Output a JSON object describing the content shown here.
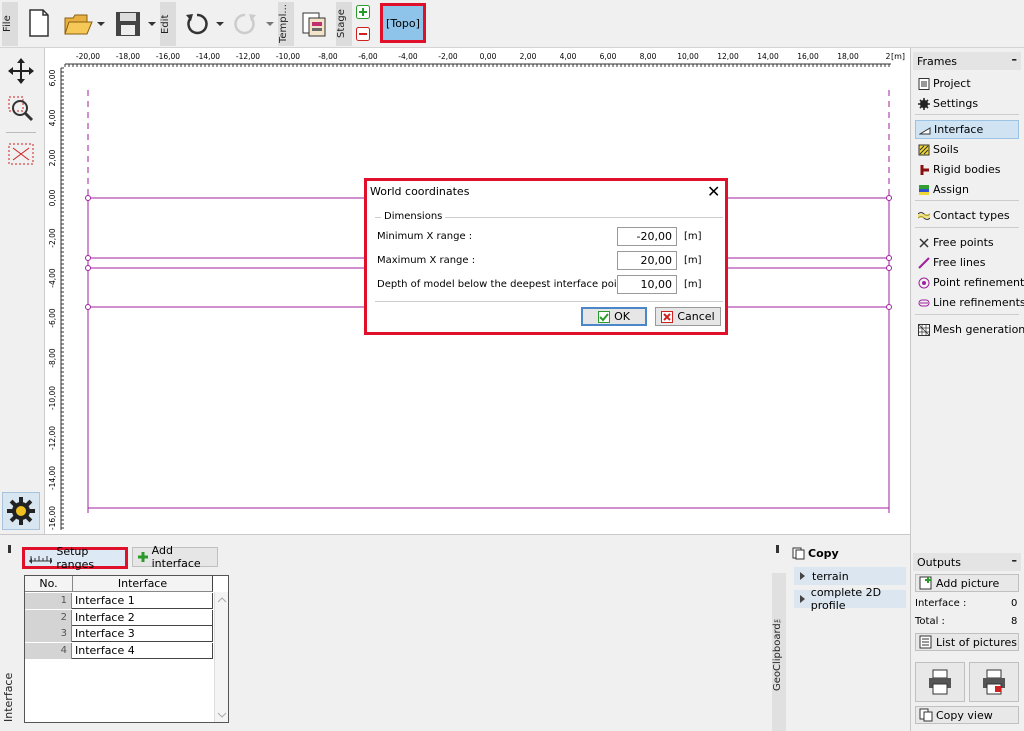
{
  "toolbar": {
    "file_label": "File",
    "edit_label": "Edit",
    "template_label": "Templ...",
    "stage_label": "Stage",
    "topo_label": "[Topo]"
  },
  "ruler": {
    "x_ticks": [
      "-20,00",
      "-18,00",
      "-16,00",
      "-14,00",
      "-12,00",
      "-10,00",
      "-8,00",
      "-6,00",
      "-4,00",
      "-2,00",
      "0,00",
      "2,00",
      "4,00",
      "6,00",
      "8,00",
      "10,00",
      "12,00",
      "14,00",
      "16,00",
      "18,00",
      "2"
    ],
    "x_unit": "[m]",
    "y_ticks": [
      "6,00",
      "4,00",
      "2,00",
      "0,00",
      "-2,00",
      "-4,00",
      "-6,00",
      "-8,00",
      "-10,00",
      "-12,00",
      "-14,00",
      "-16,00"
    ]
  },
  "frames": {
    "title": "Frames",
    "items": [
      {
        "label": "Project",
        "icon": "document-icon"
      },
      {
        "label": "Settings",
        "icon": "gear-icon"
      },
      {
        "label": "Interface",
        "icon": "interface-icon",
        "selected": true
      },
      {
        "label": "Soils",
        "icon": "soil-icon"
      },
      {
        "label": "Rigid bodies",
        "icon": "rigid-body-icon"
      },
      {
        "label": "Assign",
        "icon": "assign-icon"
      },
      {
        "label": "Contact types",
        "icon": "contact-icon"
      },
      {
        "label": "Free points",
        "icon": "free-point-icon"
      },
      {
        "label": "Free lines",
        "icon": "free-line-icon"
      },
      {
        "label": "Point refinements",
        "icon": "point-refinement-icon"
      },
      {
        "label": "Line refinements",
        "icon": "line-refinement-icon"
      },
      {
        "label": "Mesh generation",
        "icon": "mesh-icon"
      }
    ]
  },
  "outputs": {
    "title": "Outputs",
    "add_picture": "Add picture",
    "interface_label": "Interface :",
    "interface_value": "0",
    "total_label": "Total :",
    "total_value": "8",
    "list_of_pictures": "List of pictures",
    "copy_view": "Copy view"
  },
  "bottom": {
    "setup_ranges": "Setup ranges",
    "add_interface": "Add interface",
    "side_label": "Interface",
    "table": {
      "headers": [
        "No.",
        "Interface"
      ],
      "rows": [
        {
          "no": "1",
          "name": "Interface 1"
        },
        {
          "no": "2",
          "name": "Interface 2"
        },
        {
          "no": "3",
          "name": "Interface 3"
        },
        {
          "no": "4",
          "name": "Interface 4"
        }
      ]
    }
  },
  "clipboard": {
    "title": "Copy",
    "items": [
      "terrain",
      "complete 2D profile"
    ],
    "side_label": "GeoClipboard™"
  },
  "dialog": {
    "title": "World coordinates",
    "group": "Dimensions",
    "fields": [
      {
        "label": "Minimum X range :",
        "value": "-20,00",
        "unit": "[m]"
      },
      {
        "label": "Maximum X range :",
        "value": "20,00",
        "unit": "[m]"
      },
      {
        "label": "Depth of model below the deepest interface point :",
        "value": "10,00",
        "unit": "[m]"
      }
    ],
    "ok": "OK",
    "cancel": "Cancel"
  },
  "colors": {
    "highlight": "#e0102a",
    "interface_line": "#a020a0",
    "selected_bg": "#cfe3f3"
  }
}
